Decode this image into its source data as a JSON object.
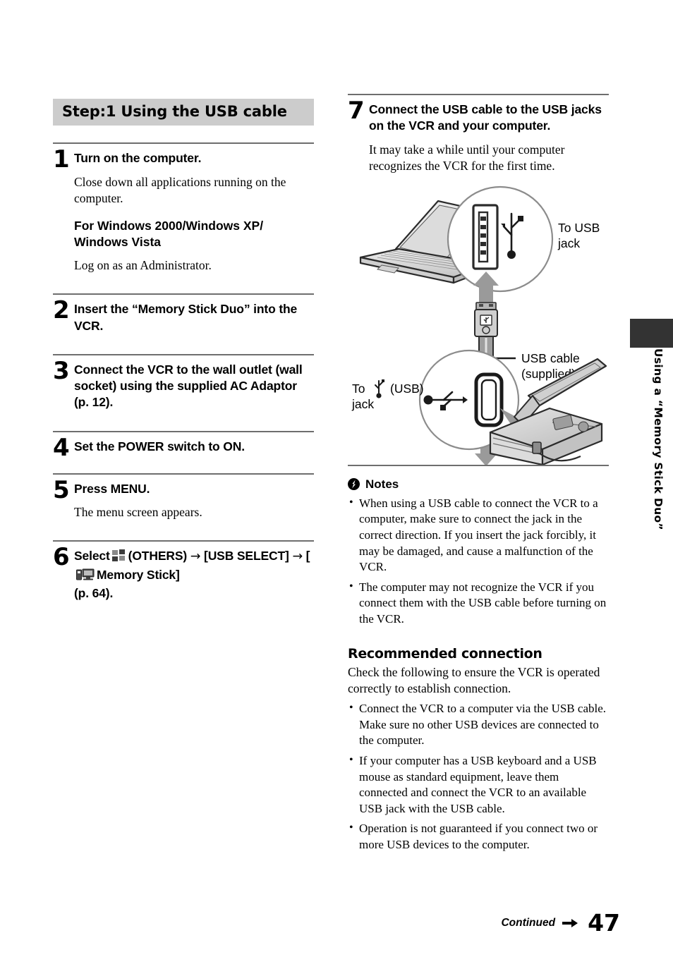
{
  "page": {
    "number": "47",
    "continued_label": "Continued",
    "side_tab_text": "Using a “Memory Stick Duo”"
  },
  "left_column": {
    "section_title": "Step:1 Using the USB cable",
    "steps": [
      {
        "number": "1",
        "title": "Turn on the computer.",
        "paragraph": "Close down all applications running on the computer.",
        "subhead": "For Windows 2000/Windows XP/ Windows Vista",
        "subparagraph": "Log on as an Administrator."
      },
      {
        "number": "2",
        "title": "Insert the “Memory Stick Duo” into the VCR."
      },
      {
        "number": "3",
        "title": "Connect the VCR to the wall outlet (wall socket) using the supplied AC Adaptor (p. 12)."
      },
      {
        "number": "4",
        "title": "Set the POWER switch to ON."
      },
      {
        "number": "5",
        "title": "Press MENU.",
        "paragraph": "The menu screen appears."
      },
      {
        "number": "6",
        "title_part1": "Select",
        "icon1": "others-grid-icon",
        "title_part2": "(OTHERS)",
        "arrow1": "→",
        "title_part3": "[USB SELECT]",
        "arrow2": "→",
        "title_part4": "[",
        "icon2": "memory-stick-computer-icon",
        "title_part5": "Memory Stick]",
        "title_part6": "(p. 64)."
      }
    ]
  },
  "right_column": {
    "step7": {
      "number": "7",
      "title": "Connect the USB cable to the USB jacks on the VCR and your computer.",
      "paragraph": "It may take a while until your computer recognizes the VCR for the first time."
    },
    "diagram": {
      "labels": {
        "to_usb_jack": "To USB\njack",
        "usb_cable": "USB cable\n(supplied)",
        "to_usb_jack_vcr_prefix": "To",
        "to_usb_jack_vcr_suffix": "(USB)\njack"
      },
      "icons": [
        "laptop-icon",
        "usb-port-icon",
        "usb-trident-icon",
        "usb-cable-icon",
        "vcr-camcorder-icon",
        "mini-usb-port-icon"
      ]
    },
    "notes": {
      "heading": "Notes",
      "icon": "note-warning-icon",
      "items": [
        "When using a USB cable to connect the VCR to a computer, make sure to connect the jack in the correct direction. If you insert the jack forcibly, it may be damaged, and cause a malfunction of the VCR.",
        "The computer may not recognize the VCR if you connect them with the USB cable before turning on the VCR."
      ]
    },
    "recommended": {
      "heading": "Recommended connection",
      "intro": "Check the following to ensure the VCR is operated correctly to establish connection.",
      "items": [
        "Connect the VCR to a computer via the USB cable. Make sure no other USB devices are connected to the computer.",
        "If your computer has a USB keyboard and a USB mouse as standard equipment, leave them connected and connect the VCR to an available USB jack with the USB cable.",
        "Operation is not guaranteed if you connect two or more USB devices to the computer."
      ]
    }
  },
  "colors": {
    "section_bar_bg": "#cccccc",
    "rule": "#6e6e6e",
    "side_tab": "#333333",
    "text": "#000000"
  }
}
